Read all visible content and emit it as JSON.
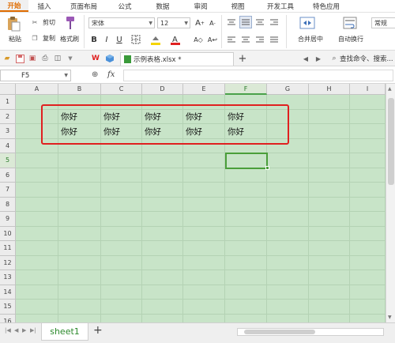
{
  "menu": {
    "tabs": [
      "开始",
      "插入",
      "页面布局",
      "公式",
      "数据",
      "审阅",
      "视图",
      "开发工具",
      "特色应用"
    ],
    "active": 0
  },
  "ribbon": {
    "paste": "粘贴",
    "cut": "剪切",
    "copy": "复制",
    "format_painter": "格式刷",
    "font_name": "宋体",
    "font_size": "12",
    "bold": "B",
    "italic": "I",
    "underline": "U",
    "merge_center": "合并居中",
    "wrap_text": "自动换行",
    "number_format": "常规"
  },
  "quickbar": {
    "file_tab": "示例表格.xlsx *",
    "search": "查找命令、搜索..."
  },
  "formula_bar": {
    "name_box": "F5",
    "fx": "fx"
  },
  "grid": {
    "columns": [
      "A",
      "B",
      "C",
      "D",
      "E",
      "F",
      "G",
      "H",
      "I"
    ],
    "rows": [
      "1",
      "2",
      "3",
      "4",
      "5",
      "6",
      "7",
      "8",
      "9",
      "10",
      "11",
      "12",
      "13",
      "14",
      "15",
      "16"
    ],
    "selected_cell": "F5",
    "cells": [
      {
        "ref": "B2",
        "value": "你好"
      },
      {
        "ref": "C2",
        "value": "你好"
      },
      {
        "ref": "D2",
        "value": "你好"
      },
      {
        "ref": "E2",
        "value": "你好"
      },
      {
        "ref": "F2",
        "value": "你好"
      },
      {
        "ref": "B3",
        "value": "你好"
      },
      {
        "ref": "C3",
        "value": "你好"
      },
      {
        "ref": "D3",
        "value": "你好"
      },
      {
        "ref": "E3",
        "value": "你好"
      },
      {
        "ref": "F3",
        "value": "你好"
      }
    ]
  },
  "sheets": {
    "tabs": [
      "sheet1"
    ],
    "add": "+"
  },
  "colors": {
    "grid_bg": "#c8e4c8",
    "accent": "#e06c00",
    "selection": "#4a9e3a",
    "highlight_box": "#e02020"
  }
}
